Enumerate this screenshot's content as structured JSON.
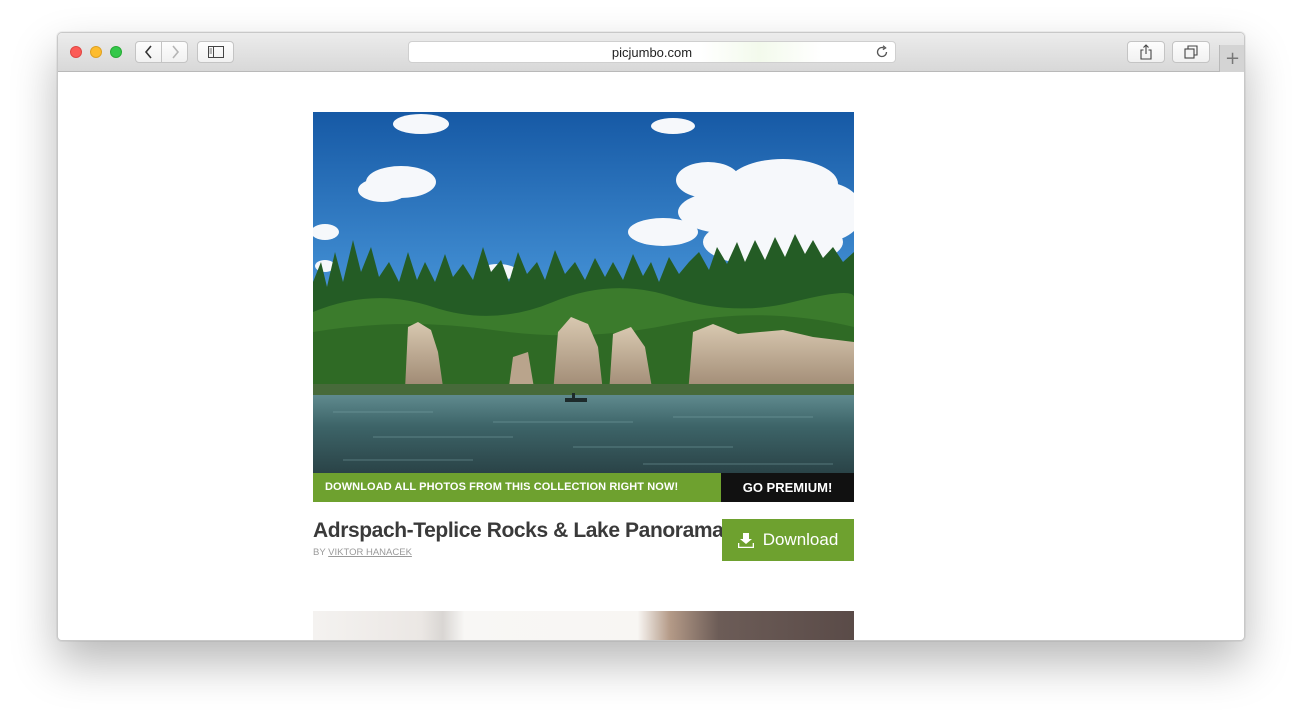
{
  "browser": {
    "url": "picjumbo.com",
    "icons": {
      "back": "chevron-left-icon",
      "forward": "chevron-right-icon",
      "sidebar": "sidebar-icon",
      "reload": "reload-icon",
      "share": "share-icon",
      "tabs": "tabs-overview-icon",
      "new_tab": "plus-icon"
    },
    "new_tab_glyph": "+"
  },
  "promo": {
    "text": "DOWNLOAD ALL PHOTOS FROM THIS COLLECTION RIGHT NOW!",
    "button": "GO PREMIUM!"
  },
  "photo": {
    "title": "Adrspach-Teplice Rocks & Lake Panorama",
    "by_label": "BY",
    "author": "VIKTOR HANACEK",
    "download_label": "Download",
    "download_icon": "download-icon"
  },
  "colors": {
    "accent_green": "#6ea12f",
    "premium_black": "#111111"
  }
}
